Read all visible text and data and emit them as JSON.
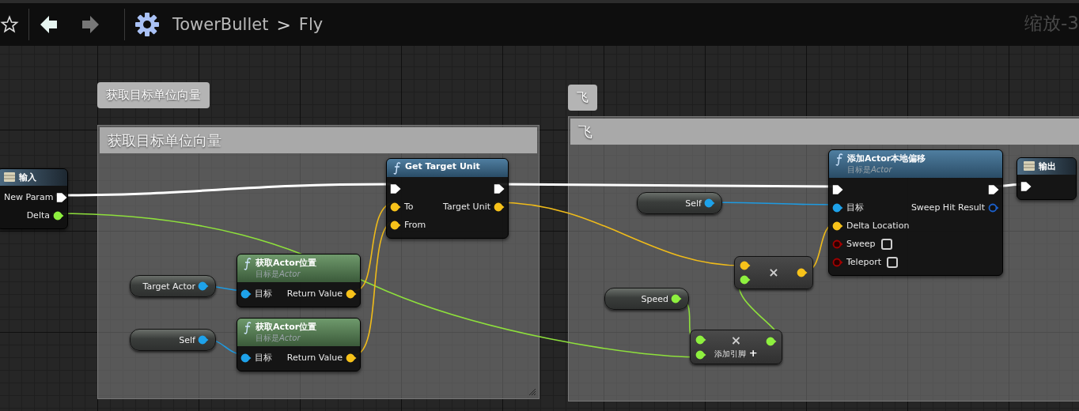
{
  "toolbar": {
    "nav": [
      {
        "kind": "back",
        "disabled": false
      },
      {
        "kind": "forward",
        "disabled": true
      }
    ],
    "breadcrumb": {
      "graph": "TowerBullet",
      "separator": ">",
      "function": "Fly"
    },
    "zoom_label": "缩放-3"
  },
  "comments": [
    {
      "bubble": "获取目标单位向量",
      "title": "获取目标单位向量"
    },
    {
      "bubble": "飞",
      "title": "飞"
    }
  ],
  "nodes": [
    {
      "kind": "event",
      "title": "输入",
      "rows": [
        {
          "right": {
            "label": "New Param",
            "kind": "exec",
            "connected": true
          }
        },
        {
          "right": {
            "label": "Delta",
            "kind": "float",
            "connected": true
          }
        }
      ]
    },
    {
      "kind": "function",
      "title": "Get Target Unit",
      "rows": [
        {
          "left": {
            "kind": "exec",
            "connected": true
          },
          "right": {
            "kind": "exec",
            "connected": true
          }
        },
        {
          "left": {
            "label": "To",
            "kind": "vector",
            "connected": true
          },
          "right": {
            "label": "Target Unit",
            "kind": "vector",
            "connected": true
          }
        },
        {
          "left": {
            "label": "From",
            "kind": "vector",
            "connected": true
          }
        }
      ]
    },
    {
      "kind": "variable",
      "label": "Target Actor",
      "pin": {
        "kind": "object",
        "connected": true
      }
    },
    {
      "kind": "pure_function",
      "title": "获取**Actor**位置",
      "subtitle": {
        "text": "目标是",
        "target": "Actor"
      },
      "rows": [
        {
          "left": {
            "label": "目标",
            "kind": "object",
            "connected": true
          },
          "right": {
            "label": "Return Value",
            "kind": "vector",
            "connected": true
          }
        }
      ]
    },
    {
      "kind": "variable",
      "label": "Self",
      "pin": {
        "kind": "object",
        "connected": true
      }
    },
    {
      "kind": "pure_function",
      "title": "获取**Actor**位置",
      "subtitle": {
        "text": "目标是",
        "target": "Actor"
      },
      "rows": [
        {
          "left": {
            "label": "目标",
            "kind": "object",
            "connected": true
          },
          "right": {
            "label": "Return Value",
            "kind": "vector",
            "connected": true
          }
        }
      ]
    },
    {
      "kind": "variable",
      "label": "Self",
      "pin": {
        "kind": "object",
        "connected": true
      }
    },
    {
      "kind": "operator",
      "symbol": "×",
      "inputs": [
        {
          "kind": "vector",
          "connected": true
        },
        {
          "kind": "float",
          "connected": true
        }
      ],
      "output": {
        "kind": "vector",
        "connected": true
      }
    },
    {
      "kind": "variable",
      "label": "Speed",
      "pin": {
        "kind": "float",
        "connected": true
      }
    },
    {
      "kind": "operator",
      "symbol": "×",
      "inputs": [
        {
          "kind": "float",
          "connected": true
        },
        {
          "kind": "float",
          "connected": true
        }
      ],
      "output": {
        "kind": "float",
        "connected": true
      },
      "add_pin": {
        "label": "添加引脚",
        "icon": "+"
      }
    },
    {
      "kind": "function",
      "title": "添加**Actor**本地偏移",
      "subtitle": {
        "text": "目标是",
        "target": "Actor"
      },
      "rows": [
        {
          "left": {
            "kind": "exec",
            "connected": true
          },
          "right": {
            "kind": "exec",
            "connected": true
          }
        },
        {
          "left": {
            "label": "目标",
            "kind": "object",
            "connected": true
          },
          "right": {
            "label": "Sweep Hit Result",
            "kind": "struct",
            "connected": false
          }
        },
        {
          "left": {
            "label": "Delta Location",
            "kind": "vector",
            "connected": true
          }
        },
        {
          "left": {
            "label": "Sweep",
            "kind": "bool",
            "connected": false,
            "checked": false
          }
        },
        {
          "left": {
            "label": "Teleport",
            "kind": "bool",
            "connected": false,
            "checked": false
          }
        }
      ]
    },
    {
      "kind": "event",
      "title": "输出",
      "rows": [
        {
          "left": {
            "kind": "exec",
            "connected": true
          }
        }
      ]
    }
  ]
}
